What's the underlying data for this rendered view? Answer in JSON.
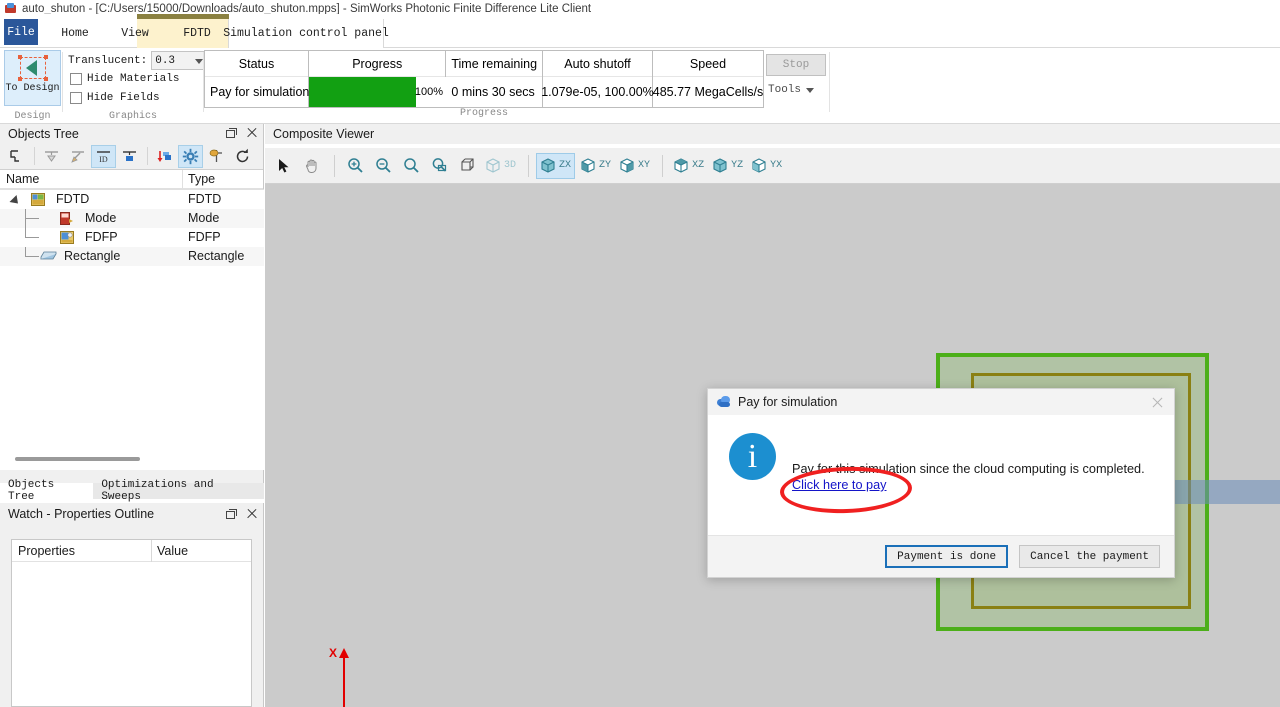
{
  "window": {
    "title": "auto_shuton - [C:/Users/15000/Downloads/auto_shuton.mpps] - SimWorks Photonic Finite Difference Lite Client",
    "icon": "app-icon"
  },
  "ribbon": {
    "tabs": [
      {
        "label": "File",
        "name": "tab-file"
      },
      {
        "label": "Home",
        "name": "tab-home"
      },
      {
        "label": "View",
        "name": "tab-view"
      },
      {
        "label": "FDTD",
        "name": "tab-fdtd"
      },
      {
        "label": "Simulation control panel",
        "name": "tab-simulation-control-panel"
      }
    ],
    "groups": {
      "design": {
        "label": "Design",
        "to_design": "To Design"
      },
      "graphics": {
        "label": "Graphics",
        "translucent_label": "Translucent:",
        "translucent_value": "0.3",
        "hide_materials": "Hide Materials",
        "hide_fields": "Hide Fields"
      },
      "progress": {
        "label": "Progress",
        "columns": [
          "Status",
          "Progress",
          "Time remaining",
          "Auto shutoff",
          "Speed"
        ],
        "status": "Pay for simulation",
        "progress_percent": "100%",
        "progress_value": 100,
        "time_remaining": "0 mins 30 secs",
        "auto_shutoff": "1.079e-05, 100.00%",
        "speed": "485.77 MegaCells/s",
        "bar_color": "#12a012"
      },
      "run": {
        "stop": "Stop",
        "tools": "Tools"
      }
    }
  },
  "objects_tree": {
    "title": "Objects Tree",
    "toolbar": [
      {
        "name": "collapse-tree-icon",
        "active": false
      },
      {
        "name": "hide-object-icon",
        "active": false
      },
      {
        "name": "pin-object-icon",
        "active": false
      },
      {
        "name": "show-id-icon",
        "active": true
      },
      {
        "name": "show-object-icon",
        "active": false
      },
      {
        "name": "move-down-icon",
        "active": false
      },
      {
        "name": "settings-gear-icon",
        "active": true
      },
      {
        "name": "mesh-order-icon",
        "active": false
      },
      {
        "name": "refresh-icon",
        "active": false
      }
    ],
    "columns": [
      "Name",
      "Type"
    ],
    "rows": [
      {
        "name": "FDTD",
        "type": "FDTD",
        "depth": 0,
        "icon": "fdtd-region-icon"
      },
      {
        "name": "Mode",
        "type": "Mode",
        "depth": 1,
        "icon": "mode-source-icon"
      },
      {
        "name": "FDFP",
        "type": "FDFP",
        "depth": 1,
        "icon": "fdfp-monitor-icon"
      },
      {
        "name": "Rectangle",
        "type": "Rectangle",
        "depth": 1,
        "icon": "rectangle-icon"
      }
    ],
    "dock_tabs": [
      {
        "label": "Objects Tree",
        "active": true
      },
      {
        "label": "Optimizations and Sweeps",
        "active": false
      }
    ]
  },
  "watch_panel": {
    "title": "Watch - Properties Outline",
    "columns": [
      "Properties",
      "Value"
    ],
    "rows": []
  },
  "viewer": {
    "title": "Composite Viewer",
    "toolbar": [
      {
        "name": "select-arrow-icon",
        "label": "",
        "active": false
      },
      {
        "name": "pan-hand-icon",
        "label": "",
        "active": false
      },
      {
        "name": "zoom-in-icon",
        "label": "",
        "active": false
      },
      {
        "name": "zoom-out-icon",
        "label": "",
        "active": false
      },
      {
        "name": "zoom-icon",
        "label": "",
        "active": false
      },
      {
        "name": "zoom-box-icon",
        "label": "",
        "active": false
      },
      {
        "name": "fit-extent-icon",
        "label": "",
        "active": false
      },
      {
        "name": "view-3d-icon",
        "label": "3D",
        "active": false
      },
      {
        "name": "view-zx-icon",
        "label": "ZX",
        "active": true
      },
      {
        "name": "view-zy-icon",
        "label": "ZY",
        "active": false
      },
      {
        "name": "view-xy-icon",
        "label": "XY",
        "active": false
      },
      {
        "name": "view-xz-icon",
        "label": "XZ",
        "active": false
      },
      {
        "name": "view-yz-icon",
        "label": "YZ",
        "active": false
      },
      {
        "name": "view-yx-icon",
        "label": "YX",
        "active": false
      }
    ],
    "axis_label": "X",
    "background_color": "#cbcbcb",
    "shapes": {
      "fdtd_region_color": "#4caf19",
      "inner_region_color": "#8a8013",
      "band_color": "#698cb9"
    }
  },
  "dialog": {
    "title": "Pay for simulation",
    "icon": "cloud-icon",
    "info_glyph": "i",
    "message": "Pay for this simulation since the cloud computing is completed.",
    "link": "Click here to pay",
    "buttons": [
      {
        "label": "Payment is done",
        "primary": true,
        "name": "payment-is-done-button"
      },
      {
        "label": "Cancel the payment",
        "primary": false,
        "name": "cancel-the-payment-button"
      }
    ],
    "annotation_color": "#f02020"
  }
}
